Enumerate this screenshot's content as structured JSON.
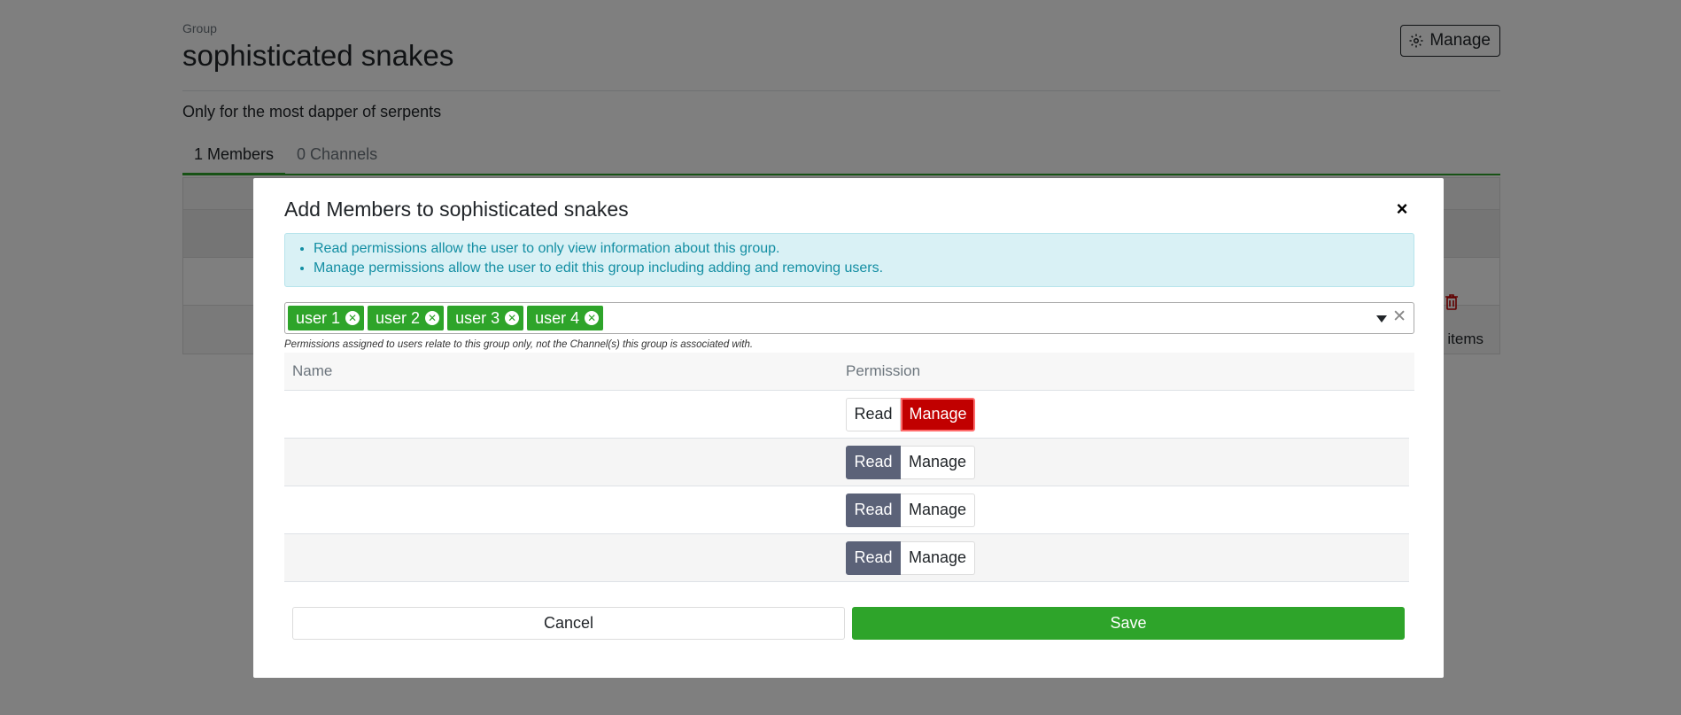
{
  "page": {
    "breadcrumb": "Group",
    "title": "sophisticated snakes",
    "manage_label": "Manage",
    "description": "Only for the most dapper of serpents",
    "tabs": [
      {
        "label": "1 Members",
        "active": true
      },
      {
        "label": "0 Channels",
        "active": false
      }
    ],
    "pager_items_label": "items"
  },
  "modal": {
    "title": "Add Members to sophisticated snakes",
    "close_label": "×",
    "info_items": [
      "Read permissions allow the user to only view information about this group.",
      "Manage permissions allow the user to edit this group including adding and removing users."
    ],
    "selected_users": [
      "user 1",
      "user 2",
      "user 3",
      "user 4"
    ],
    "note": "Permissions assigned to users relate to this group only, not the Channel(s) this group is associated with.",
    "table_headers": {
      "name": "Name",
      "permission": "Permission"
    },
    "permission_labels": {
      "read": "Read",
      "manage": "Manage"
    },
    "rows": [
      {
        "name": "",
        "permission": "Manage"
      },
      {
        "name": "",
        "permission": "Read"
      },
      {
        "name": "",
        "permission": "Read"
      },
      {
        "name": "",
        "permission": "Read"
      }
    ],
    "cancel_label": "Cancel",
    "save_label": "Save"
  },
  "colors": {
    "accent_green": "#2ea42a",
    "info_text": "#138ea3",
    "read_active": "#5b6278",
    "manage_active": "#c10000"
  }
}
